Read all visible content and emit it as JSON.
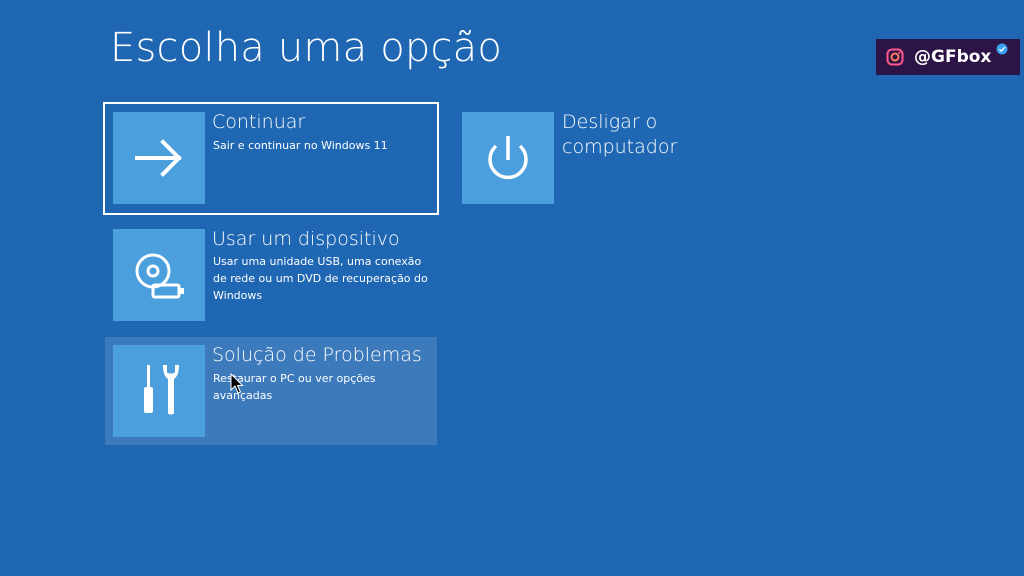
{
  "page": {
    "title": "Escolha uma opção"
  },
  "options": [
    {
      "title": "Continuar",
      "description": "Sair e continuar no Windows 11",
      "icon": "arrow-right-icon",
      "state": "selected"
    },
    {
      "title": "Usar um dispositivo",
      "description": "Usar uma unidade USB, uma conexão de rede ou um DVD de recuperação do Windows",
      "icon": "disc-usb-icon",
      "state": "normal"
    },
    {
      "title": "Solução de Problemas",
      "description": "Restaurar o PC ou ver opções avançadas",
      "icon": "tools-icon",
      "state": "hover"
    }
  ],
  "power": {
    "title": "Desligar o computador",
    "icon": "power-icon"
  },
  "watermark": {
    "handle": "@GFbox",
    "icon": "instagram-icon",
    "verified_icon": "verified-badge-icon"
  },
  "colors": {
    "background": "#1f67b3",
    "tile": "#4a9fdc",
    "hover": "#3d7abc",
    "badge_bg": "#2d1446"
  }
}
